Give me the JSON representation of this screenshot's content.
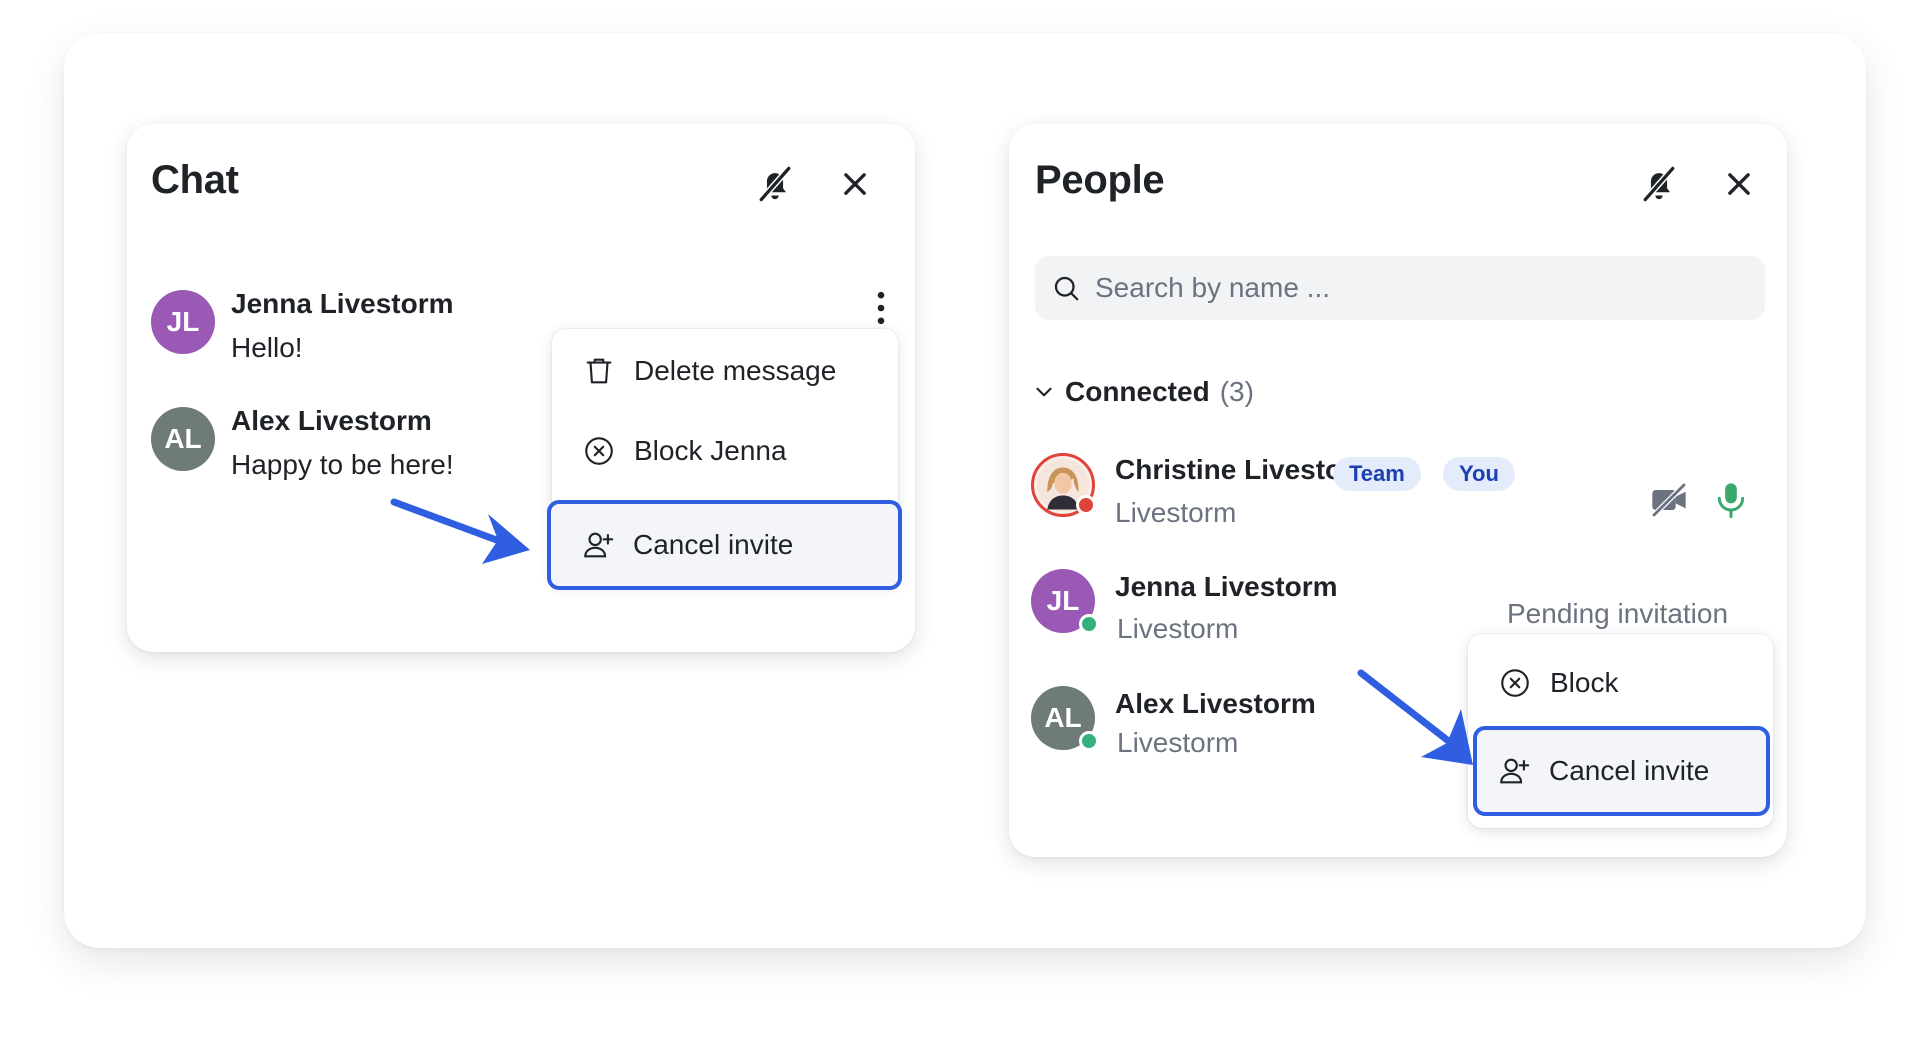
{
  "chat": {
    "title": "Chat",
    "messages": [
      {
        "initials": "JL",
        "author": "Jenna Livestorm",
        "text": "Hello!"
      },
      {
        "initials": "AL",
        "author": "Alex Livestorm",
        "text": "Happy to be here!"
      }
    ],
    "menu": {
      "delete_label": "Delete message",
      "block_label": "Block Jenna",
      "cancel_label": "Cancel invite"
    }
  },
  "people": {
    "title": "People",
    "search": {
      "placeholder": "Search by name ..."
    },
    "group": {
      "label": "Connected",
      "count": "(3)"
    },
    "participants": [
      {
        "name": "Christine Livestorm",
        "company": "Livestorm",
        "badges": [
          "Team",
          "You"
        ]
      },
      {
        "initials": "JL",
        "name": "Jenna Livestorm",
        "company": "Livestorm",
        "status": "Pending invitation"
      },
      {
        "initials": "AL",
        "name": "Alex Livestorm",
        "company": "Livestorm"
      }
    ],
    "menu": {
      "block_label": "Block",
      "cancel_label": "Cancel invite"
    }
  },
  "icons": [
    "bell-off-icon",
    "close-icon",
    "kebab-menu-icon",
    "trash-icon",
    "block-circle-x-icon",
    "user-plus-icon",
    "search-icon",
    "chevron-down-icon",
    "video-off-icon",
    "microphone-icon",
    "arrow-pointer-icon"
  ],
  "colors": {
    "accent_blue": "#2f5ee0",
    "avatar_purple": "#9b59b6",
    "avatar_gray": "#6e7b79",
    "status_green": "#33b07e",
    "status_red": "#e0433a",
    "badge_bg": "#e4ebfb",
    "badge_text": "#1d3fb0",
    "mic_green": "#3ba96b"
  }
}
